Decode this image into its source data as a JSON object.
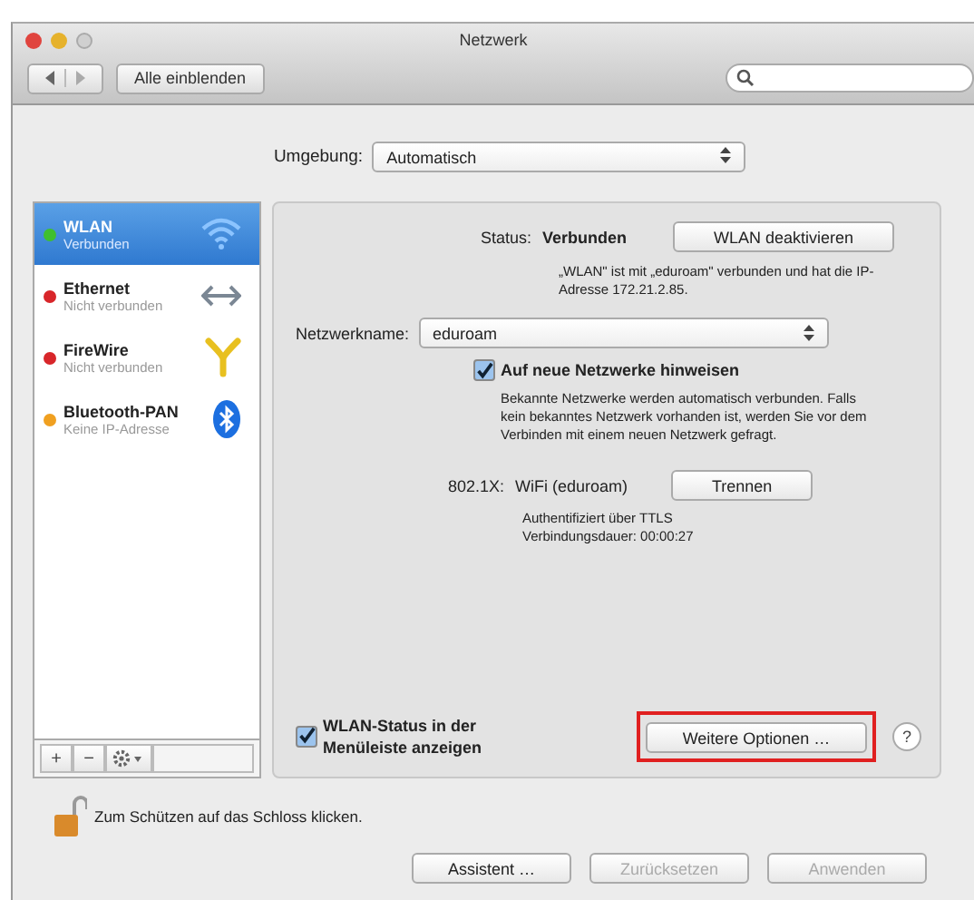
{
  "window": {
    "title": "Netzwerk"
  },
  "toolbar": {
    "show_all": "Alle einblenden"
  },
  "location": {
    "label": "Umgebung:",
    "value": "Automatisch"
  },
  "services": [
    {
      "name": "WLAN",
      "status": "Verbunden",
      "color": "#3fbf2f",
      "selected": true,
      "kind": "wifi"
    },
    {
      "name": "Ethernet",
      "status": "Nicht verbunden",
      "color": "#d8262a",
      "selected": false,
      "kind": "ethernet"
    },
    {
      "name": "FireWire",
      "status": "Nicht verbunden",
      "color": "#d8262a",
      "selected": false,
      "kind": "firewire"
    },
    {
      "name": "Bluetooth-PAN",
      "status": "Keine IP-Adresse",
      "color": "#f0a020",
      "selected": false,
      "kind": "bluetooth"
    }
  ],
  "sidebar_tools": [
    "+",
    "−"
  ],
  "details": {
    "status_label": "Status:",
    "status_value": "Verbunden",
    "status_button": "WLAN deaktivieren",
    "status_description": "„WLAN\" ist mit „eduroam\" verbunden und hat die IP-Adresse 172.21.2.85.",
    "network_label": "Netzwerkname:",
    "network_value": "eduroam",
    "ask_checkbox": {
      "label": "Auf neue Netzwerke hinweisen",
      "checked": true
    },
    "ask_hint": "Bekannte Netzwerke werden automatisch verbunden. Falls kein bekanntes Netzwerk vorhanden ist, werden Sie vor dem Verbinden mit einem neuen Netzwerk gefragt.",
    "dot1x_label": "802.1X:",
    "dot1x_value": "WiFi (eduroam)",
    "dot1x_button": "Trennen",
    "dot1x_info": [
      "Authentifiziert über TTLS",
      "Verbindungsdauer: 00:00:27"
    ],
    "menu_checkbox": {
      "label": "WLAN-Status in der Menüleiste anzeigen",
      "checked": true
    },
    "more_button": {
      "label": "Weitere Optionen …",
      "highlighted": true
    },
    "help": "?"
  },
  "lock_text": "Zum Schützen auf das Schloss klicken.",
  "buttons": [
    {
      "label": "Assistent …",
      "disabled": false
    },
    {
      "label": "Zurücksetzen",
      "disabled": true
    },
    {
      "label": "Anwenden",
      "disabled": true
    }
  ]
}
